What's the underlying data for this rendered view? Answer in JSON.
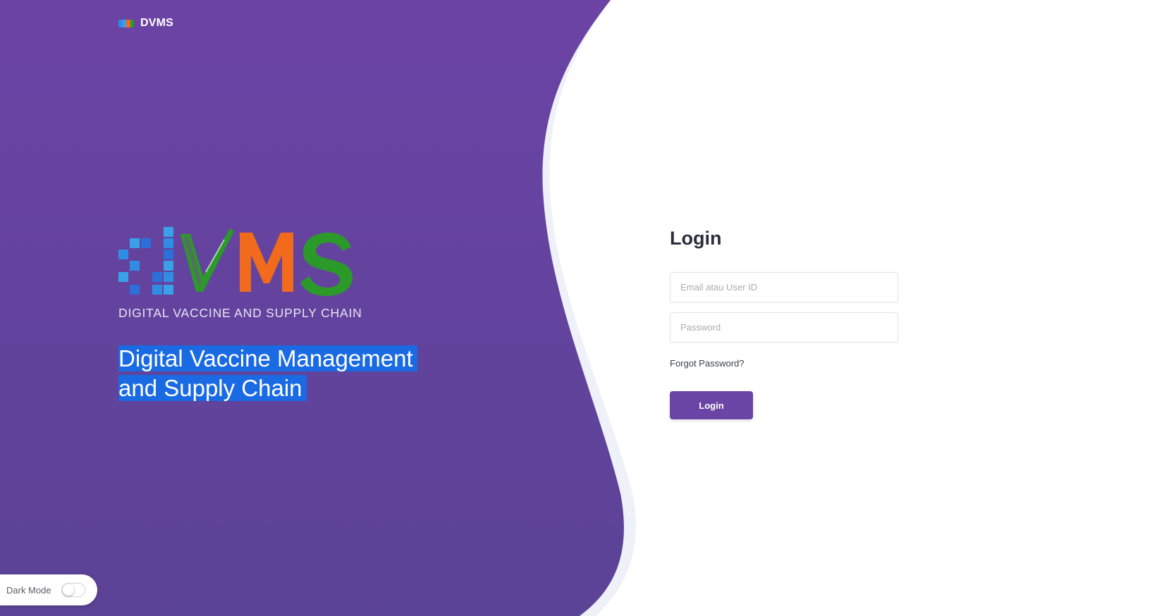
{
  "brand": {
    "name": "DVMS",
    "logo_tagline": "DIGITAL VACCINE AND SUPPLY CHAIN"
  },
  "hero": {
    "headline_line1": "Digital Vaccine Management",
    "headline_line2": "and Supply Chain"
  },
  "login": {
    "title": "Login",
    "email_placeholder": "Email atau User ID",
    "password_placeholder": "Password",
    "forgot_label": "Forgot Password?",
    "submit_label": "Login"
  },
  "dark_mode": {
    "label": "Dark Mode",
    "enabled": false
  },
  "colors": {
    "panel_top": "#6b43a5",
    "panel_bottom": "#5b4396",
    "accent_button": "#6a45a5",
    "selection_highlight": "#1a6ae3",
    "logo_blue": "#2f8de4",
    "logo_orange": "#f26a1b",
    "logo_green": "#2b9a28"
  }
}
